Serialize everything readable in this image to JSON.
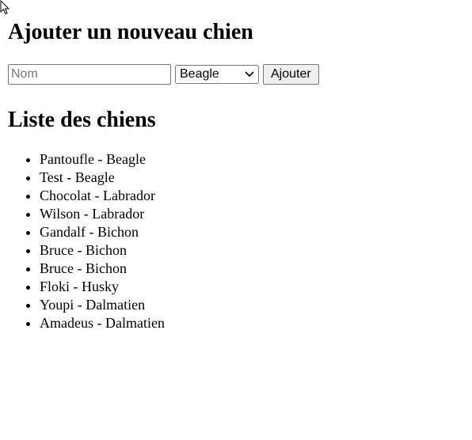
{
  "form": {
    "heading": "Ajouter un nouveau chien",
    "name_placeholder": "Nom",
    "breed_selected": "Beagle",
    "submit_label": "Ajouter"
  },
  "list": {
    "heading": "Liste des chiens",
    "items": [
      {
        "text": "Pantoufle - Beagle"
      },
      {
        "text": "Test - Beagle"
      },
      {
        "text": "Chocolat - Labrador"
      },
      {
        "text": "Wilson - Labrador"
      },
      {
        "text": "Gandalf - Bichon"
      },
      {
        "text": "Bruce - Bichon"
      },
      {
        "text": "Bruce - Bichon"
      },
      {
        "text": "Floki - Husky"
      },
      {
        "text": "Youpi - Dalmatien"
      },
      {
        "text": "Amadeus - Dalmatien"
      }
    ]
  },
  "icons": {
    "cursor": "mouse-pointer-icon",
    "select_arrow": "chevron-down-icon"
  }
}
